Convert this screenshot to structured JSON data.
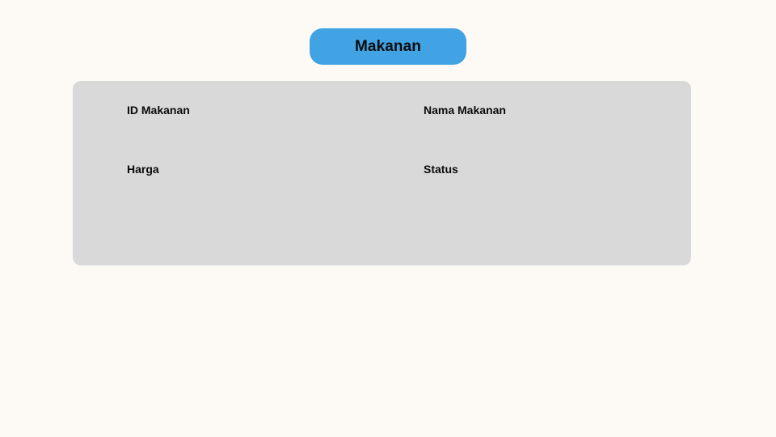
{
  "header": {
    "title": "Makanan"
  },
  "form": {
    "fields": [
      {
        "label": "ID Makanan"
      },
      {
        "label": "Nama Makanan"
      },
      {
        "label": "Harga"
      },
      {
        "label": "Status"
      }
    ]
  },
  "colors": {
    "background": "#fdfaf6",
    "title_pill": "#41a2e4",
    "panel": "#d9d9d9",
    "text": "#0a0a0a"
  }
}
